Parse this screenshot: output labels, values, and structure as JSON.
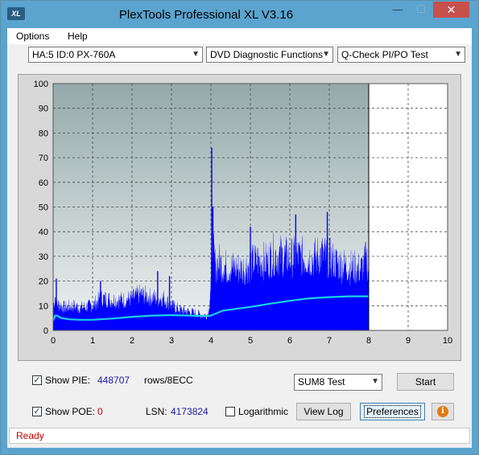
{
  "window": {
    "title": "PlexTools Professional XL V3.16",
    "app_icon_text": "XL",
    "min_label": "—",
    "max_label": "☐",
    "close_label": "✕"
  },
  "menu": {
    "options": "Options",
    "help": "Help"
  },
  "toolbar": {
    "drive": "HA:5 ID:0  PX-760A",
    "function": "DVD Diagnostic Functions",
    "test": "Q-Check PI/PO Test"
  },
  "chart_data": {
    "type": "area",
    "xlim": [
      0,
      10
    ],
    "ylim": [
      0,
      100
    ],
    "x_ticks": [
      "0",
      "1",
      "2",
      "3",
      "4",
      "5",
      "6",
      "7",
      "8",
      "9",
      "10"
    ],
    "y_ticks": [
      "0",
      "10",
      "20",
      "30",
      "40",
      "50",
      "60",
      "70",
      "80",
      "90",
      "100"
    ],
    "grid": true,
    "scan_end": 8,
    "series": [
      {
        "kind": "pie_bars",
        "color": "#0000ff",
        "x": [
          0.0,
          0.05,
          0.1,
          0.2,
          0.3,
          0.5,
          0.7,
          1.0,
          1.1,
          1.2,
          1.5,
          1.8,
          2.0,
          2.2,
          2.4,
          2.6,
          2.8,
          3.0,
          3.2,
          3.4,
          3.6,
          3.8,
          3.9,
          3.95,
          4.0,
          4.02,
          4.1,
          4.2,
          4.4,
          4.6,
          4.8,
          5.0,
          5.2,
          5.4,
          5.6,
          5.8,
          6.0,
          6.2,
          6.4,
          6.6,
          6.8,
          7.0,
          7.2,
          7.4,
          7.6,
          7.8,
          7.95,
          8.0
        ],
        "y": [
          13,
          18,
          14,
          13,
          12,
          13,
          12,
          13,
          15,
          17,
          16,
          16,
          17,
          19,
          18,
          17,
          17,
          13,
          11,
          10,
          9,
          8,
          8,
          12,
          26,
          48,
          34,
          36,
          33,
          33,
          32,
          35,
          37,
          36,
          40,
          39,
          38,
          39,
          38,
          38,
          40,
          38,
          35,
          34,
          33,
          32,
          38,
          31
        ],
        "spikes": [
          {
            "x": 4.02,
            "y": 74
          },
          {
            "x": 4.05,
            "y": 50
          },
          {
            "x": 2.65,
            "y": 24
          },
          {
            "x": 2.95,
            "y": 22
          },
          {
            "x": 1.2,
            "y": 20
          },
          {
            "x": 0.08,
            "y": 21
          },
          {
            "x": 6.95,
            "y": 48
          },
          {
            "x": 6.15,
            "y": 47
          },
          {
            "x": 5.0,
            "y": 42
          }
        ]
      },
      {
        "kind": "avg_line",
        "color": "#19d3e0",
        "x": [
          0.0,
          0.05,
          0.1,
          0.2,
          0.4,
          0.7,
          1.0,
          1.5,
          2.0,
          2.5,
          3.0,
          3.5,
          3.9,
          4.0,
          4.3,
          5.0,
          5.5,
          6.0,
          6.5,
          7.0,
          7.5,
          8.0
        ],
        "y": [
          4,
          6,
          6,
          5,
          4.5,
          4.3,
          4.3,
          4.8,
          5.5,
          6,
          6.2,
          6.0,
          5.8,
          6.0,
          8,
          9.5,
          10.8,
          12,
          13,
          13.5,
          13.8,
          13.8
        ]
      }
    ]
  },
  "controls": {
    "show_pie_label": "Show PIE:",
    "show_pie_checked": "✓",
    "pie_value": "448707",
    "pie_unit": "rows/8ECC",
    "show_poe_label": "Show POE:",
    "show_poe_checked": "✓",
    "poe_value": "0",
    "lsn_label": "LSN:",
    "lsn_value": "4173824",
    "logarithmic_label": "Logarithmic",
    "sum_select": "SUM8 Test",
    "start_button": "Start",
    "view_log_button": "View Log",
    "preferences_button": "Preferences",
    "info_icon": "i"
  },
  "status": {
    "text": "Ready"
  }
}
